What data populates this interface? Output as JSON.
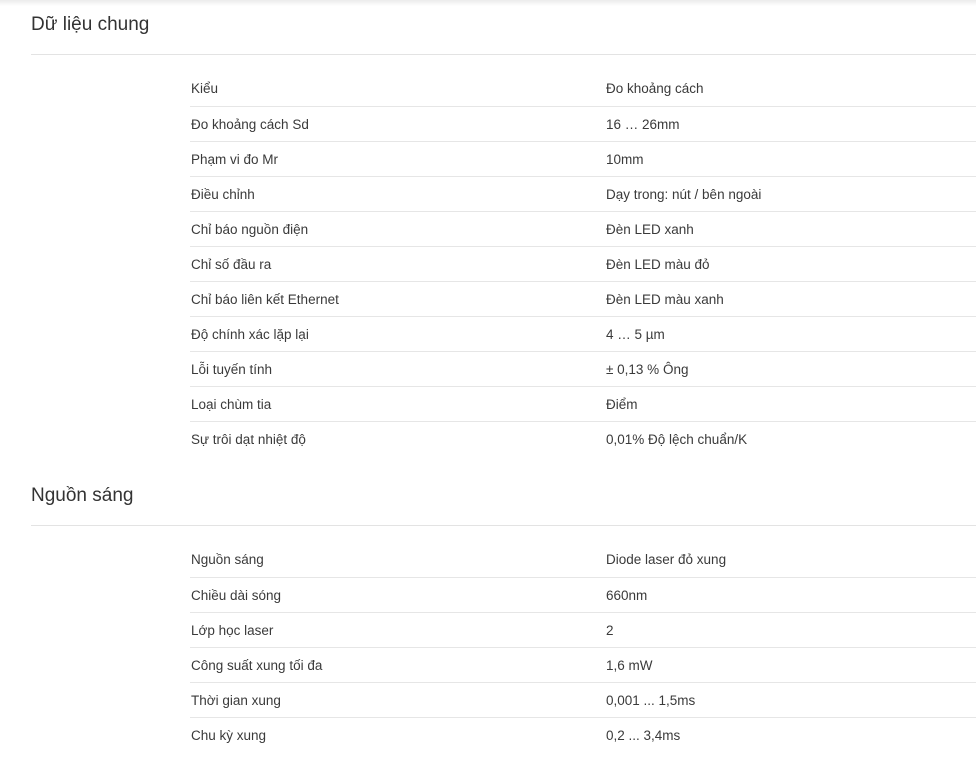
{
  "general": {
    "title": "Dữ liệu chung",
    "rows": [
      {
        "label": "Kiểu",
        "value": "Đo khoảng cách"
      },
      {
        "label": "Đo khoảng cách Sd",
        "value": "16 … 26mm"
      },
      {
        "label": "Phạm vi đo Mr",
        "value": "10mm"
      },
      {
        "label": "Điều chỉnh",
        "value": "Dạy trong: nút / bên ngoài"
      },
      {
        "label": "Chỉ báo nguồn điện",
        "value": "Đèn LED xanh"
      },
      {
        "label": "Chỉ số đầu ra",
        "value": "Đèn LED màu đỏ"
      },
      {
        "label": "Chỉ báo liên kết Ethernet",
        "value": "Đèn LED màu xanh"
      },
      {
        "label": "Độ chính xác lặp lại",
        "value": "4 … 5 µm"
      },
      {
        "label": "Lỗi tuyến tính",
        "value": "± 0,13 % Ông"
      },
      {
        "label": "Loại chùm tia",
        "value": "Điểm"
      },
      {
        "label": "Sự trôi dạt nhiệt độ",
        "value": "0,01% Độ lệch chuẩn/K"
      }
    ]
  },
  "light_source": {
    "title": "Nguồn sáng",
    "rows": [
      {
        "label": "Nguồn sáng",
        "value": "Diode laser đỏ xung"
      },
      {
        "label": "Chiều dài sóng",
        "value": "660nm"
      },
      {
        "label": "Lớp học laser",
        "value": "2"
      },
      {
        "label": "Công suất xung tối đa",
        "value": "1,6 mW"
      },
      {
        "label": "Thời gian xung",
        "value": "0,001 ... 1,5ms"
      },
      {
        "label": "Chu kỳ xung",
        "value": "0,2 ... 3,4ms"
      }
    ]
  }
}
